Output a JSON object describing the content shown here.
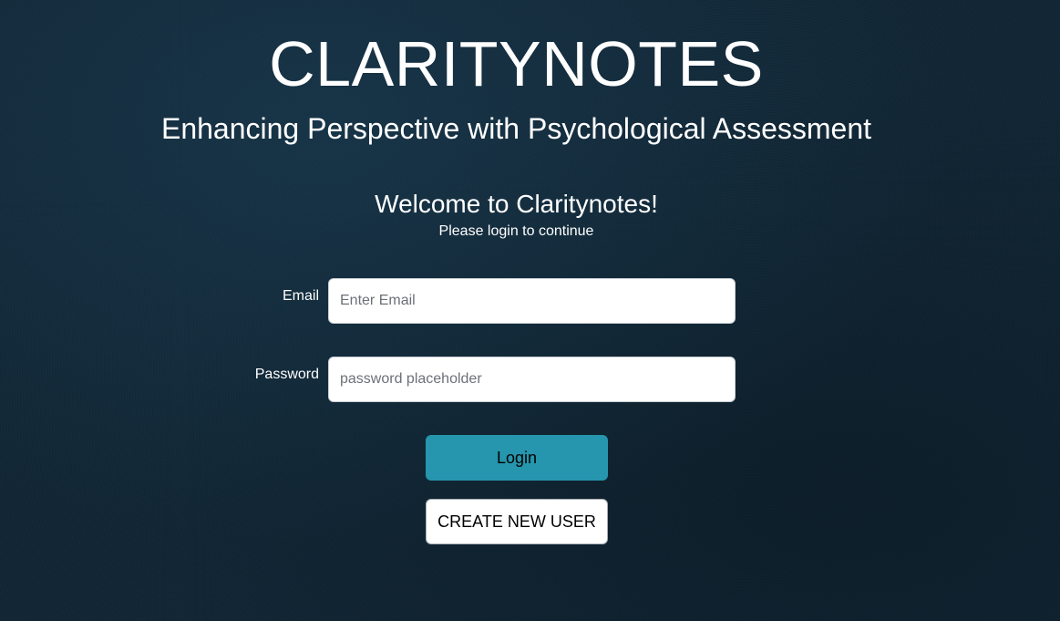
{
  "brand": {
    "title": "CLARITYNOTES",
    "subtitle": "Enhancing Perspective with Psychological Assessment"
  },
  "welcome": {
    "title": "Welcome to Claritynotes!",
    "subtitle": "Please login to continue"
  },
  "form": {
    "email": {
      "label": "Email",
      "placeholder": "Enter Email",
      "value": ""
    },
    "password": {
      "label": "Password",
      "placeholder": "password placeholder",
      "value": ""
    },
    "login_label": "Login",
    "create_user_label": "CREATE NEW USER"
  },
  "colors": {
    "background": "#0f2433",
    "login_button": "#2596ae",
    "text": "#ffffff"
  }
}
